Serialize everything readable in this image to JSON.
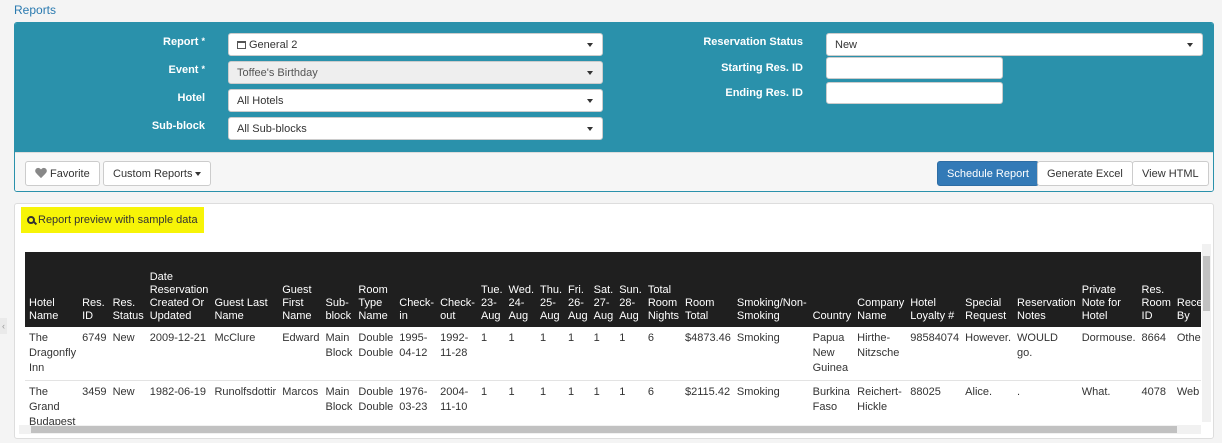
{
  "breadcrumb": "Reports",
  "filters": {
    "report_label": "Report",
    "report_value": "General 2",
    "event_label": "Event",
    "event_value": "Toffee's Birthday",
    "hotel_label": "Hotel",
    "hotel_value": "All Hotels",
    "subblock_label": "Sub-block",
    "subblock_value": "All Sub-blocks",
    "required_mark": "*",
    "res_status_label": "Reservation Status",
    "res_status_value": "New",
    "start_id_label": "Starting Res. ID",
    "start_id_value": "",
    "end_id_label": "Ending Res. ID",
    "end_id_value": ""
  },
  "toolbar": {
    "favorite": "Favorite",
    "custom_reports": "Custom Reports",
    "schedule": "Schedule Report",
    "excel": "Generate Excel",
    "html": "View HTML"
  },
  "preview_label": "Report preview with sample data",
  "table": {
    "columns": [
      "Hotel Name",
      "Res. ID",
      "Res. Status",
      "Date Reservation Created Or Updated",
      "Guest Last Name",
      "Guest First Name",
      "Sub-block",
      "Room Type Name",
      "Check-in",
      "Check-out",
      "Tue. 23-Aug",
      "Wed. 24-Aug",
      "Thu. 25-Aug",
      "Fri. 26-Aug",
      "Sat. 27-Aug",
      "Sun. 28-Aug",
      "Total Room Nights",
      "Room Total",
      "Smoking/Non-Smoking",
      "Country",
      "Company Name",
      "Hotel Loyalty #",
      "Special Request",
      "Reservation Notes",
      "Private Note for Hotel",
      "Res. Room ID",
      "Received By"
    ],
    "rows": [
      [
        "The Dragonfly Inn",
        "6749",
        "New",
        "2009-12-21",
        "McClure",
        "Edward",
        "Main Block",
        "Double Double",
        "1995-04-12",
        "1992-11-28",
        "1",
        "1",
        "1",
        "1",
        "1",
        "1",
        "6",
        "$4873.46",
        "Smoking",
        "Papua New Guinea",
        "Hirthe-Nitzsche",
        "98584074",
        "However.",
        "WOULD go.",
        "Dormouse.",
        "8664",
        "Other"
      ],
      [
        "The Grand Budapest",
        "3459",
        "New",
        "1982-06-19",
        "Runolfsdottir",
        "Marcos",
        "Main Block",
        "Double Double",
        "1976-03-23",
        "2004-11-10",
        "1",
        "1",
        "1",
        "1",
        "1",
        "1",
        "6",
        "$2115.42",
        "Smoking",
        "Burkina Faso",
        "Reichert-Hickle",
        "88025",
        "Alice.",
        ".",
        "What.",
        "4078",
        "Web"
      ]
    ]
  },
  "colors": {
    "header_bg": "#2a91ab",
    "primary": "#337ab7",
    "highlight": "#f7f407",
    "table_head": "#1f1f1f"
  }
}
